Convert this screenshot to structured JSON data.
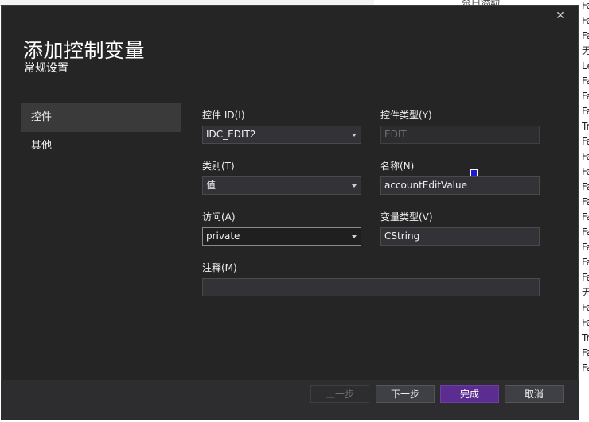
{
  "background": {
    "top_text": "杀白添动",
    "right_items": [
      "Fa",
      "Fa",
      "Fa",
      "无",
      "Le",
      "Fa",
      "Fa",
      "Fa",
      "Tr",
      "Fa",
      "Fa",
      "Fa",
      "Fa",
      "Fa",
      "Fa",
      "Fa",
      "Fa",
      "Fa",
      "Fa",
      "无",
      "Fa",
      "Fa",
      "Tr",
      "Fa",
      "Fa"
    ]
  },
  "dialog": {
    "close_glyph": "✕",
    "title": "添加控制变量",
    "subtitle": "常规设置",
    "nav": [
      {
        "label": "控件"
      },
      {
        "label": "其他"
      }
    ],
    "form": {
      "control_id": {
        "label": "控件 ID(I)",
        "value": "IDC_EDIT2"
      },
      "control_type": {
        "label": "控件类型(Y)",
        "value": "EDIT"
      },
      "category": {
        "label": "类别(T)",
        "value": "值"
      },
      "name": {
        "label": "名称(N)",
        "value": "accountEditValue"
      },
      "access": {
        "label": "访问(A)",
        "value": "private"
      },
      "variable_type": {
        "label": "变量类型(V)",
        "value": "CString"
      },
      "comment": {
        "label": "注释(M)",
        "value": ""
      }
    },
    "buttons": {
      "prev": "上一步",
      "next": "下一步",
      "finish": "完成",
      "cancel": "取消"
    }
  },
  "colors": {
    "dialog_bg": "#252526",
    "primary_button": "#5c2d91",
    "field_bg": "#333337"
  }
}
